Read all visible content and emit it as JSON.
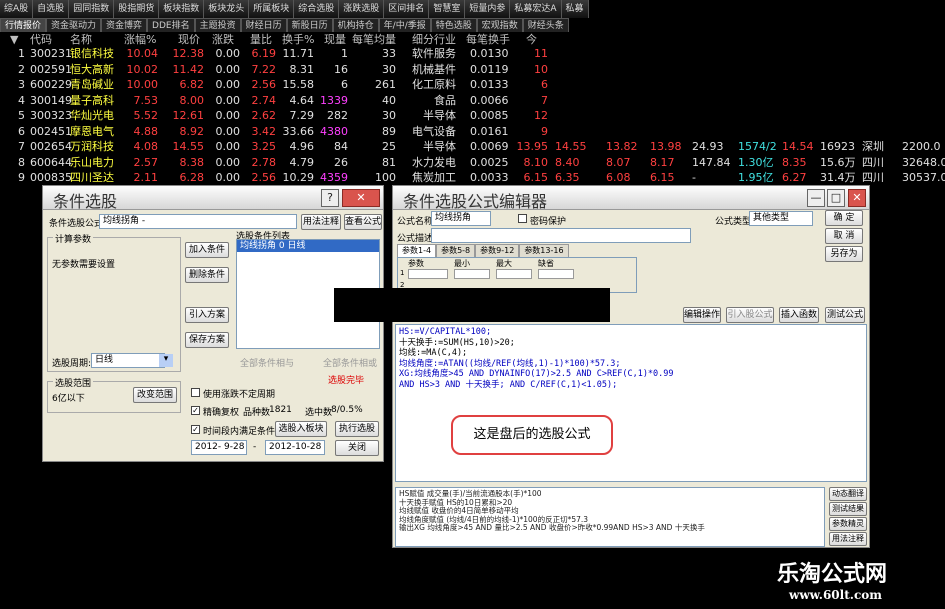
{
  "toolbar": [
    "综A股",
    "自选股",
    "园同指数",
    "股指期货",
    "板块指数",
    "板块龙头",
    "所属板块",
    "综合选股",
    "涨跌选股",
    "区间排名",
    "智慧室",
    "短量内参",
    "私募宏达A",
    "私募"
  ],
  "tabs": [
    "行情报价",
    "资金驱动力",
    "资金博弈",
    "DDE排名",
    "主题投资",
    "财经日历",
    "新股日历",
    "机构持仓",
    "年/中/季报",
    "特色选股",
    "宏观指数",
    "财经头条"
  ],
  "table": {
    "headers": [
      "代码",
      "名称",
      "涨幅%",
      "现价",
      "涨跌",
      "量比",
      "换手%",
      "现量",
      "每笔均量",
      "细分行业",
      "每笔换手",
      "今"
    ],
    "rows": [
      {
        "n": "1",
        "code": "300231",
        "name": "银信科技",
        "pct": "10.04",
        "price": "12.38",
        "chg": "0.00",
        "vr": "6.19",
        "turn": "11.71",
        "vol": "1",
        "avg": "33",
        "ind": "软件服务",
        "tpt": "0.0130",
        "x": "11",
        "ext": []
      },
      {
        "n": "2",
        "code": "002591",
        "name": "恒大高新",
        "pct": "10.02",
        "price": "11.42",
        "chg": "0.00",
        "vr": "7.22",
        "turn": "8.31",
        "vol": "16",
        "avg": "30",
        "ind": "机械基件",
        "tpt": "0.0119",
        "x": "10",
        "ext": []
      },
      {
        "n": "3",
        "code": "600229",
        "name": "青岛碱业",
        "pct": "10.00",
        "price": "6.82",
        "chg": "0.00",
        "vr": "2.56",
        "turn": "15.58",
        "vol": "6",
        "avg": "261",
        "ind": "化工原料",
        "tpt": "0.0133",
        "x": "6",
        "ext": []
      },
      {
        "n": "4",
        "code": "300149",
        "name": "量子高科",
        "pct": "7.53",
        "price": "8.00",
        "chg": "0.00",
        "vr": "2.74",
        "turn": "4.64",
        "vol": "1339",
        "avg": "40",
        "ind": "食品",
        "tpt": "0.0066",
        "x": "7",
        "ext": []
      },
      {
        "n": "5",
        "code": "300323",
        "name": "华灿光电",
        "pct": "5.52",
        "price": "12.61",
        "chg": "0.00",
        "vr": "2.62",
        "turn": "7.29",
        "vol": "282",
        "avg": "30",
        "ind": "半导体",
        "tpt": "0.0085",
        "x": "12",
        "ext": []
      },
      {
        "n": "6",
        "code": "002451",
        "name": "摩恩电气",
        "pct": "4.88",
        "price": "8.92",
        "chg": "0.00",
        "vr": "3.42",
        "turn": "33.66",
        "vol": "4380",
        "avg": "89",
        "ind": "电气设备",
        "tpt": "0.0161",
        "x": "9",
        "ext": []
      },
      {
        "n": "7",
        "code": "002654",
        "name": "万润科技",
        "pct": "4.08",
        "price": "14.55",
        "chg": "0.00",
        "vr": "3.25",
        "turn": "4.96",
        "vol": "84",
        "avg": "25",
        "ind": "半导体",
        "tpt": "0.0069",
        "x": "13.95",
        "ext": [
          "14.55",
          "13.82",
          "13.98",
          "24.93",
          "1574/2",
          "14.54",
          "16923",
          "深圳",
          "2200.0"
        ]
      },
      {
        "n": "8",
        "code": "600644",
        "name": "乐山电力",
        "pct": "2.57",
        "price": "8.38",
        "chg": "0.00",
        "vr": "2.78",
        "turn": "4.79",
        "vol": "26",
        "avg": "81",
        "ind": "水力发电",
        "tpt": "0.0025",
        "x": "8.10",
        "ext": [
          "8.40",
          "8.07",
          "8.17",
          "147.84",
          "1.30亿",
          "8.35",
          "15.6万",
          "四川",
          "32648.0"
        ]
      },
      {
        "n": "9",
        "code": "000835",
        "name": "四川圣达",
        "pct": "2.11",
        "price": "6.28",
        "chg": "0.00",
        "vr": "2.56",
        "turn": "10.29",
        "vol": "4359",
        "avg": "100",
        "ind": "焦炭加工",
        "tpt": "0.0033",
        "x": "6.15",
        "ext": [
          "6.35",
          "6.08",
          "6.15",
          "-",
          "1.95亿",
          "6.27",
          "31.4万",
          "四川",
          "30537.0"
        ]
      }
    ]
  },
  "dialog1": {
    "title": "条件选股",
    "formula_label": "条件选股公式",
    "formula_value": "均线拐角 -",
    "usage_btn": "用法注释",
    "view_btn": "查看公式",
    "calc_params": "计算参数",
    "no_params": "无参数需要设置",
    "list_title": "选股条件列表",
    "list_item": "均线拐角  0  日线",
    "add_btn": "加入条件",
    "del_btn": "删除条件",
    "import_btn": "引入方案",
    "save_btn": "保存方案",
    "period_label": "选股周期:",
    "period_value": "日线",
    "radio_all": "全部条件相与",
    "radio_or": "全部条件相或",
    "status": "选股完毕",
    "range_title": "选股范围",
    "range_value": "6亿以下",
    "change_range_btn": "改变范围",
    "chk1": "使用涨跌不定周期",
    "chk2": "精确复权",
    "stock_count_label": "品种数",
    "stock_count": "1821",
    "selected_label": "选中数",
    "selected_value": "8/0.5%",
    "chk3": "时间段内满足条件",
    "date_from": "2012- 9-28",
    "date_to": "2012-10-28",
    "to_block_btn": "选股入板块",
    "run_btn": "执行选股",
    "close_btn": "关闭"
  },
  "dialog2": {
    "title": "条件选股公式编辑器",
    "name_label": "公式名称",
    "name_value": "均线拐角",
    "pwd_label": "密码保护",
    "desc_label": "公式描述",
    "type_label": "公式类型",
    "type_value": "其他类型",
    "ok_btn": "确  定",
    "cancel_btn": "取  消",
    "saveas_btn": "另存为",
    "param_tabs": [
      "参数1-4",
      "参数5-8",
      "参数9-12",
      "参数13-16"
    ],
    "param_cols": [
      "参数",
      "最小",
      "最大",
      "缺省"
    ],
    "edit_btn": "编辑操作",
    "import_btn": "引入股公式",
    "insert_btn": "插入函数",
    "test_btn": "测试公式",
    "formula_lines": [
      "HS:=V/CAPITAL*100;",
      "十天换手:=SUM(HS,10)>20;",
      "均线:=MA(C,4);",
      "均线角度:=ATAN((均线/REF(均线,1)-1)*100)*57.3;",
      "XG:均线角度>45 AND DYNAINFO(17)>2.5 AND C>REF(C,1)*0.99",
      "AND HS>3 AND 十天换手; AND C/REF(C,1)<1.05);"
    ],
    "annotation": "这是盘后的选股公式",
    "help_lines": [
      "HS赋值 成交量(手)/当前流通股本(手)*100",
      "十天换手赋值 HS的10日累和>20",
      "均线赋值 收盘价的4日简单移动平均",
      "均线角度赋值 (均线/4日前的均线-1)*100的反正切*57.3",
      "输出XG 均线角度>45 AND 量比>2.5 AND 收盘价>昨收*0.99AND HS>3 AND 十天换手"
    ],
    "side_btns": [
      "动态翻译",
      "测试结果",
      "参数精灵",
      "用法注释"
    ]
  },
  "watermark": {
    "line1": "乐淘公式网",
    "line2": "www.60lt.com"
  }
}
